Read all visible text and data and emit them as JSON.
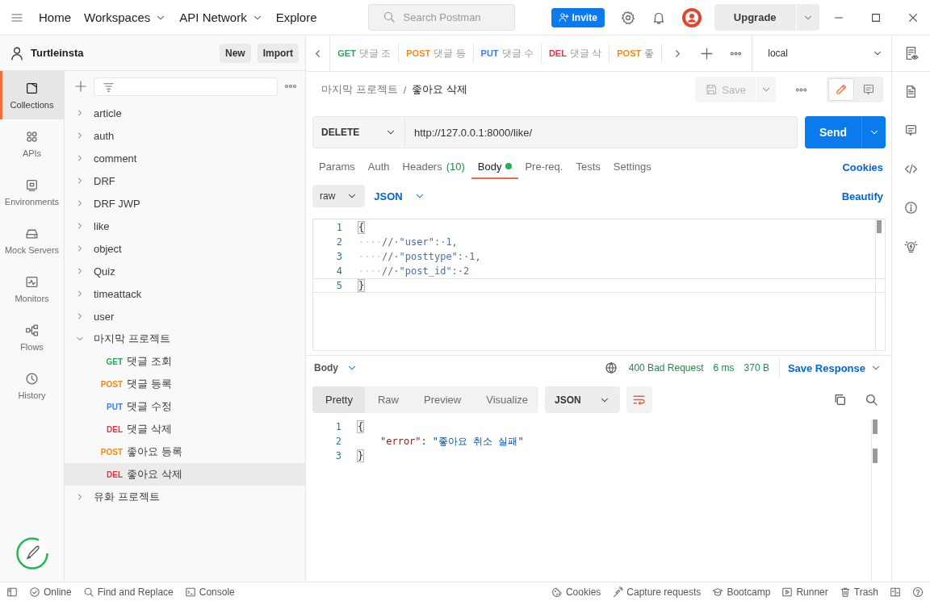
{
  "top_bar": {
    "nav": [
      {
        "label": "Home",
        "dropdown": false
      },
      {
        "label": "Workspaces",
        "dropdown": true
      },
      {
        "label": "API Network",
        "dropdown": true
      },
      {
        "label": "Explore",
        "dropdown": false
      }
    ],
    "search": {
      "placeholder": "Search Postman"
    },
    "invite": "Invite",
    "upgrade": "Upgrade"
  },
  "workspace": {
    "name": "Turtleinsta",
    "buttons": [
      "New",
      "Import"
    ]
  },
  "nav_rail": [
    {
      "label": "Collections",
      "selected": true
    },
    {
      "label": "APIs",
      "selected": false
    },
    {
      "label": "Environments",
      "selected": false
    },
    {
      "label": "Mock Servers",
      "selected": false
    },
    {
      "label": "Monitors",
      "selected": false
    },
    {
      "label": "Flows",
      "selected": false
    },
    {
      "label": "History",
      "selected": false
    }
  ],
  "collections": [
    {
      "name": "article",
      "expanded": false
    },
    {
      "name": "auth",
      "expanded": false
    },
    {
      "name": "comment",
      "expanded": false
    },
    {
      "name": "DRF",
      "expanded": false
    },
    {
      "name": "DRF JWP",
      "expanded": false
    },
    {
      "name": "like",
      "expanded": false
    },
    {
      "name": "object",
      "expanded": false
    },
    {
      "name": "Quiz",
      "expanded": false
    },
    {
      "name": "timeattack",
      "expanded": false
    },
    {
      "name": "user",
      "expanded": false
    },
    {
      "name": "마지막 프로젝트",
      "expanded": true,
      "children": [
        {
          "method": "GET",
          "color": "#2ba35a",
          "name": "댓글 조회",
          "selected": false
        },
        {
          "method": "POST",
          "color": "#f08b1e",
          "name": "댓글 등록",
          "selected": false
        },
        {
          "method": "PUT",
          "color": "#3b7ee8",
          "name": "댓글 수정",
          "selected": false
        },
        {
          "method": "DEL",
          "color": "#d9364b",
          "name": "댓글 삭제",
          "selected": false
        },
        {
          "method": "POST",
          "color": "#f08b1e",
          "name": "좋아요 등록",
          "selected": false
        },
        {
          "method": "DEL",
          "color": "#d9364b",
          "name": "좋아요 삭제",
          "selected": true
        }
      ]
    },
    {
      "name": "유화 프로젝트",
      "expanded": false
    }
  ],
  "request_tabs": {
    "items": [
      {
        "method": "GET",
        "color": "#2ba35a",
        "name": "댓글 조"
      },
      {
        "method": "POST",
        "color": "#f08b1e",
        "name": "댓글 등"
      },
      {
        "method": "PUT",
        "color": "#3b7ee8",
        "name": "댓글 수"
      },
      {
        "method": "DEL",
        "color": "#d9364b",
        "name": "댓글 삭"
      },
      {
        "method": "POST",
        "color": "#f08b1e",
        "name": "좋"
      }
    ],
    "environment": "local"
  },
  "breadcrumb": {
    "parent": "마지막 프로젝트",
    "separator": "/",
    "current": "좋아요 삭제"
  },
  "save": {
    "label": "Save",
    "disabled": true
  },
  "mode_toggle": [
    {
      "kind": "edit",
      "selected": true
    },
    {
      "kind": "comments",
      "selected": false
    }
  ],
  "request": {
    "method": "DELETE",
    "url": "http://127.0.0.1:8000/like/",
    "send": "Send"
  },
  "request_sections": [
    {
      "label": "Params",
      "dot": false,
      "selected": false
    },
    {
      "label": "Auth",
      "dot": false,
      "selected": false
    },
    {
      "label": "Headers",
      "count": "(10)",
      "dot": false,
      "selected": false
    },
    {
      "label": "Body",
      "dot": true,
      "selected": true
    },
    {
      "label": "Pre-req.",
      "dot": false,
      "selected": false
    },
    {
      "label": "Tests",
      "dot": false,
      "selected": false
    },
    {
      "label": "Settings",
      "dot": false,
      "selected": false
    }
  ],
  "cookies_link": "Cookies",
  "body": {
    "mode": "raw",
    "language": "JSON",
    "beautify": "Beautify",
    "lines": [
      {
        "number": "1",
        "tokens": [
          {
            "kind": "bracket",
            "text": "{"
          }
        ]
      },
      {
        "number": "2",
        "tokens": [
          {
            "kind": "whitespace",
            "text": "····"
          },
          {
            "kind": "comment",
            "text": "//·\"user\":·1,"
          }
        ]
      },
      {
        "number": "3",
        "tokens": [
          {
            "kind": "whitespace",
            "text": "····"
          },
          {
            "kind": "comment",
            "text": "//·\"posttype\":·1,"
          }
        ]
      },
      {
        "number": "4",
        "tokens": [
          {
            "kind": "whitespace",
            "text": "····"
          },
          {
            "kind": "comment",
            "text": "//·\"post_id\":·2"
          }
        ]
      },
      {
        "number": "5",
        "tokens": [
          {
            "kind": "bracket",
            "text": "}"
          }
        ]
      }
    ]
  },
  "response": {
    "label": "Body",
    "status": "400 Bad Request",
    "time": "6 ms",
    "size": "370 B",
    "save": "Save Response",
    "views": [
      {
        "label": "Pretty",
        "selected": true
      },
      {
        "label": "Raw",
        "selected": false
      },
      {
        "label": "Preview",
        "selected": false
      },
      {
        "label": "Visualize",
        "selected": false
      }
    ],
    "language": "JSON",
    "lines": [
      {
        "number": "1",
        "indented": false,
        "tokens": [
          {
            "kind": "bracket",
            "text": "{"
          }
        ]
      },
      {
        "number": "2",
        "indented": true,
        "tokens": [
          {
            "kind": "key",
            "text": "\"error\""
          },
          {
            "kind": "punct",
            "text": ":"
          },
          {
            "kind": "string",
            "text": "\"좋아요 취소 실패\""
          }
        ]
      },
      {
        "number": "3",
        "indented": false,
        "tokens": [
          {
            "kind": "bracket",
            "text": "}"
          }
        ]
      }
    ]
  },
  "status_bar": {
    "left": [
      "Online",
      "Find and Replace",
      "Console"
    ],
    "right": [
      "Cookies",
      "Capture requests",
      "Bootcamp",
      "Runner",
      "Trash"
    ]
  }
}
